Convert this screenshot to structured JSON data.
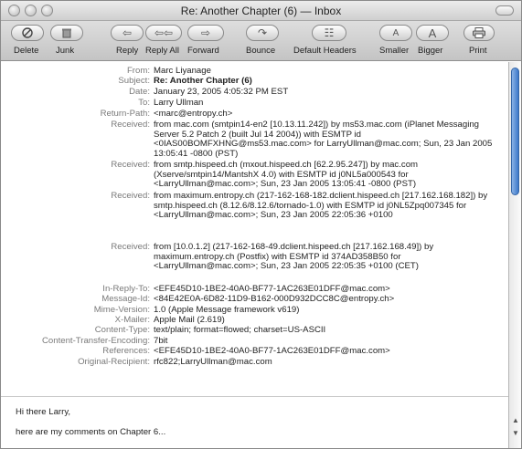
{
  "window": {
    "title": "Re: Another Chapter (6) — Inbox"
  },
  "toolbar": {
    "delete": "Delete",
    "junk": "Junk",
    "reply": "Reply",
    "reply_all": "Reply All",
    "forward": "Forward",
    "bounce": "Bounce",
    "default_headers": "Default Headers",
    "smaller": "Smaller",
    "bigger": "Bigger",
    "print": "Print"
  },
  "headers": [
    {
      "key": "From:",
      "value": "Marc Liyanage"
    },
    {
      "key": "Subject:",
      "value": "Re: Another Chapter (6)"
    },
    {
      "key": "Date:",
      "value": "January 23, 2005 4:05:32 PM EST"
    },
    {
      "key": "To:",
      "value": "Larry Ullman"
    },
    {
      "key": "Return-Path:",
      "value": "<marc@entropy.ch>"
    },
    {
      "key": "Received:",
      "value": "from mac.com (smtpin14-en2 [10.13.11.242]) by ms53.mac.com (iPlanet Messaging Server 5.2 Patch 2 (built Jul 14 2004)) with ESMTP id <0IAS00BOMFXHNG@ms53.mac.com> for LarryUllman@mac.com; Sun, 23 Jan 2005 13:05:41 -0800 (PST)"
    },
    {
      "key": "Received:",
      "value": "from smtp.hispeed.ch (mxout.hispeed.ch [62.2.95.247]) by mac.com (Xserve/smtpin14/MantshX 4.0) with ESMTP id j0NL5a000543 for <LarryUllman@mac.com>; Sun, 23 Jan 2005 13:05:41 -0800 (PST)"
    },
    {
      "key": "Received:",
      "value": "from maximum.entropy.ch (217-162-168-182.dclient.hispeed.ch [217.162.168.182]) by smtp.hispeed.ch (8.12.6/8.12.6/tornado-1.0) with ESMTP id j0NL5Zpq007345 for <LarryUllman@mac.com>; Sun, 23 Jan 2005 22:05:36 +0100"
    },
    {
      "key": "Received:",
      "value": "from [10.0.1.2] (217-162-168-49.dclient.hispeed.ch [217.162.168.49]) by maximum.entropy.ch (Postfix) with ESMTP id 374AD358B50 for <LarryUllman@mac.com>; Sun, 23 Jan 2005 22:05:35 +0100 (CET)"
    },
    {
      "key": "In-Reply-To:",
      "value": "<EFE45D10-1BE2-40A0-BF77-1AC263E01DFF@mac.com>"
    },
    {
      "key": "Message-Id:",
      "value": "<84E42E0A-6D82-11D9-B162-000D932DCC8C@entropy.ch>"
    },
    {
      "key": "Mime-Version:",
      "value": "1.0 (Apple Message framework v619)"
    },
    {
      "key": "X-Mailer:",
      "value": "Apple Mail (2.619)"
    },
    {
      "key": "Content-Type:",
      "value": "text/plain; format=flowed; charset=US-ASCII"
    },
    {
      "key": "Content-Transfer-Encoding:",
      "value": "7bit"
    },
    {
      "key": "References:",
      "value": "<EFE45D10-1BE2-40A0-BF77-1AC263E01DFF@mac.com>"
    },
    {
      "key": "Original-Recipient:",
      "value": "rfc822;LarryUllman@mac.com"
    }
  ],
  "body": {
    "greeting": "Hi there Larry,",
    "line1": "here are my comments on Chapter 6..."
  }
}
